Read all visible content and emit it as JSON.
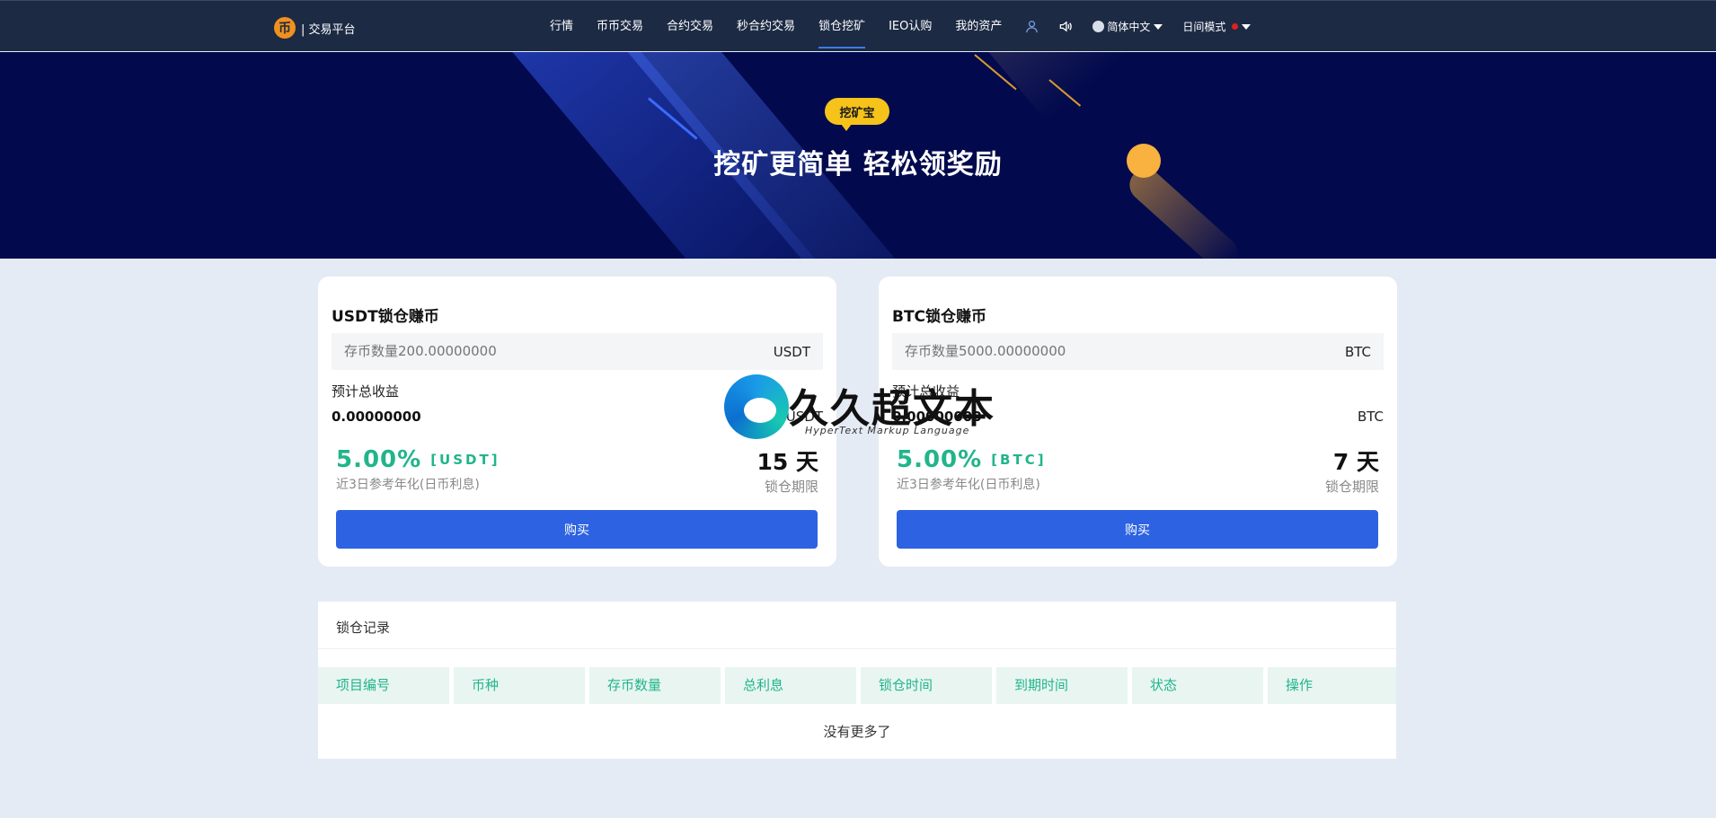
{
  "header": {
    "brand_logo_char": "币",
    "brand_text": "| 交易平台",
    "nav": [
      "行情",
      "币币交易",
      "合约交易",
      "秒合约交易",
      "锁仓挖矿",
      "IEO认购",
      "我的资产"
    ],
    "active_nav": "锁仓挖矿",
    "language": "简体中文",
    "mode": "日间模式",
    "icons": [
      "user-icon",
      "speaker-icon",
      "globe-icon"
    ]
  },
  "banner": {
    "badge": "挖矿宝",
    "title": "挖矿更简单 轻松领奖励"
  },
  "cards": [
    {
      "title": "USDT锁仓赚币",
      "amount_placeholder": "存币数量200.00000000",
      "unit": "USDT",
      "est_label": "预计总收益",
      "est_value": "0.00000000",
      "rate": "5.00%",
      "rate_unit": "[USDT]",
      "rate_desc": "近3日参考年化(日币利息)",
      "period": "15 天",
      "period_label": "锁仓期限",
      "buy_label": "购买"
    },
    {
      "title": "BTC锁仓赚币",
      "amount_placeholder": "存币数量5000.00000000",
      "unit": "BTC",
      "est_label": "预计总收益",
      "est_value": "0.00000000",
      "rate": "5.00%",
      "rate_unit": "[BTC]",
      "rate_desc": "近3日参考年化(日币利息)",
      "period": "7 天",
      "period_label": "锁仓期限",
      "buy_label": "购买"
    }
  ],
  "records": {
    "title": "锁仓记录",
    "columns": [
      "项目编号",
      "币种",
      "存币数量",
      "总利息",
      "锁仓时间",
      "到期时间",
      "状态",
      "操作"
    ],
    "empty_text": "没有更多了"
  },
  "watermark": {
    "text": "久久超文本",
    "subtext": "HyperText Markup Language"
  },
  "colors": {
    "header_bg": "#1c2a44",
    "banner_bg": "#020a4d",
    "accent_green": "#20b58b",
    "button_blue": "#2d63e2",
    "badge_yellow": "#f5c31a"
  }
}
